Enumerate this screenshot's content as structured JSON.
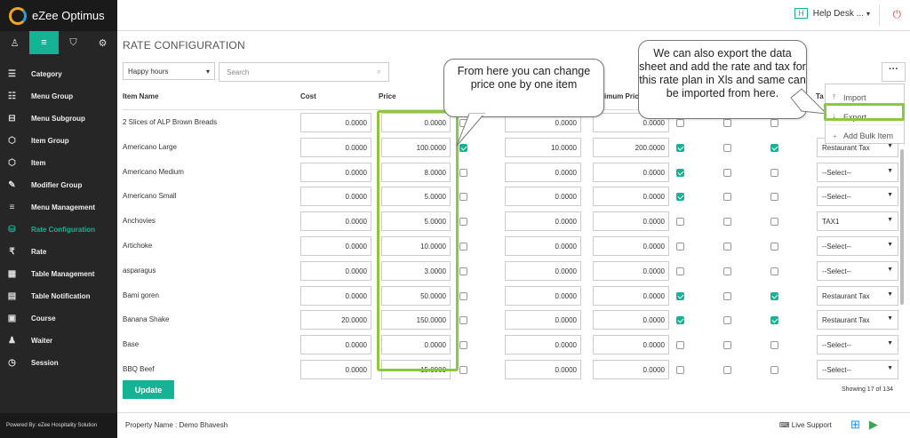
{
  "app": {
    "logo_text": "eZee Optimus"
  },
  "sidebar": {
    "tabs": [
      {
        "label": "♙",
        "icon": "user-icon"
      },
      {
        "label": "≡",
        "icon": "menu-icon"
      },
      {
        "label": "⛉",
        "icon": "store-icon"
      },
      {
        "label": "⚙",
        "icon": "gear-icon"
      }
    ],
    "items": [
      {
        "label": "Category",
        "icon": "☰"
      },
      {
        "label": "Menu Group",
        "icon": "☷"
      },
      {
        "label": "Menu Subgroup",
        "icon": "⊟"
      },
      {
        "label": "Item Group",
        "icon": "⬡"
      },
      {
        "label": "Item",
        "icon": "⬡"
      },
      {
        "label": "Modifier Group",
        "icon": "✎"
      },
      {
        "label": "Menu Management",
        "icon": "≡"
      },
      {
        "label": "Rate Configuration",
        "icon": "⛁"
      },
      {
        "label": "Rate",
        "icon": "₹"
      },
      {
        "label": "Table Management",
        "icon": "▦"
      },
      {
        "label": "Table Notification",
        "icon": "▤"
      },
      {
        "label": "Course",
        "icon": "▣"
      },
      {
        "label": "Waiter",
        "icon": "♟"
      },
      {
        "label": "Session",
        "icon": "◷"
      }
    ],
    "powered_by": "Powered By: eZee Hospitality Solution"
  },
  "topbar": {
    "help_badge": "H",
    "help_label": "Help Desk ...",
    "caret": "▾",
    "power_icon": "⏻"
  },
  "page": {
    "title": "RATE CONFIGURATION",
    "filter_value": "Happy hours",
    "filter_caret": "▾",
    "search_placeholder": "Search",
    "search_icon": "⌕",
    "more_label": "···"
  },
  "table": {
    "headers": {
      "item_name": "Item Name",
      "cost": "Cost",
      "price": "Price",
      "min_price": "imum Pric",
      "tax": "Ta"
    },
    "rows": [
      {
        "name": "2 Slices of ALP Brown Breads",
        "cost": "0.0000",
        "price": "0.0000",
        "p3": "0.0000",
        "p4": "0.0000",
        "c1": false,
        "c2": false,
        "c3": false,
        "c4": false,
        "tax": ""
      },
      {
        "name": "Americano Large",
        "cost": "0.0000",
        "price": "100.0000",
        "p3": "10.0000",
        "p4": "200.0000",
        "c1": true,
        "c2": true,
        "c3": false,
        "c4": true,
        "tax": "Restaurant Tax"
      },
      {
        "name": "Americano Medium",
        "cost": "0.0000",
        "price": "8.0000",
        "p3": "0.0000",
        "p4": "0.0000",
        "c1": false,
        "c2": true,
        "c3": false,
        "c4": false,
        "tax": "--Select--"
      },
      {
        "name": "Americano Small",
        "cost": "0.0000",
        "price": "5.0000",
        "p3": "0.0000",
        "p4": "0.0000",
        "c1": false,
        "c2": true,
        "c3": false,
        "c4": false,
        "tax": "--Select--"
      },
      {
        "name": "Anchovies",
        "cost": "0.0000",
        "price": "5.0000",
        "p3": "0.0000",
        "p4": "0.0000",
        "c1": false,
        "c2": false,
        "c3": false,
        "c4": false,
        "tax": "TAX1"
      },
      {
        "name": "Artichoke",
        "cost": "0.0000",
        "price": "10.0000",
        "p3": "0.0000",
        "p4": "0.0000",
        "c1": false,
        "c2": false,
        "c3": false,
        "c4": false,
        "tax": "--Select--"
      },
      {
        "name": "asparagus",
        "cost": "0.0000",
        "price": "3.0000",
        "p3": "0.0000",
        "p4": "0.0000",
        "c1": false,
        "c2": false,
        "c3": false,
        "c4": false,
        "tax": "--Select--"
      },
      {
        "name": "Bami goren",
        "cost": "0.0000",
        "price": "50.0000",
        "p3": "0.0000",
        "p4": "0.0000",
        "c1": false,
        "c2": true,
        "c3": false,
        "c4": true,
        "tax": "Restaurant Tax"
      },
      {
        "name": "Banana Shake",
        "cost": "20.0000",
        "price": "150.0000",
        "p3": "0.0000",
        "p4": "0.0000",
        "c1": false,
        "c2": true,
        "c3": false,
        "c4": true,
        "tax": "Restaurant Tax"
      },
      {
        "name": "Base",
        "cost": "0.0000",
        "price": "0.0000",
        "p3": "0.0000",
        "p4": "0.0000",
        "c1": false,
        "c2": false,
        "c3": false,
        "c4": false,
        "tax": "--Select--"
      },
      {
        "name": "BBQ Beef",
        "cost": "0.0000",
        "price": "15.0000",
        "p3": "0.0000",
        "p4": "0.0000",
        "c1": false,
        "c2": false,
        "c3": false,
        "c4": false,
        "tax": "--Select--"
      }
    ]
  },
  "dropdown_menu": {
    "import": "Import",
    "export": "Export",
    "add_bulk": "Add Bulk Item",
    "import_icon": "⤒",
    "export_icon": "⤓",
    "add_icon": "+"
  },
  "callouts": {
    "price": "From here you can change  price one by one item",
    "export": "We can also export the data sheet and add the rate and tax for this rate plan in Xls and same can be imported from here."
  },
  "actions": {
    "update": "Update",
    "showing": "Showing 17 of 134"
  },
  "footer": {
    "property": "Property Name : Demo Bhavesh",
    "live_support": "Live Support",
    "live_icon": "⌨",
    "apps": [
      "⊞",
      "▶",
      ""
    ]
  },
  "colors": {
    "accent": "#16b295",
    "highlight": "#8dc63f",
    "sidebar": "#262626"
  }
}
